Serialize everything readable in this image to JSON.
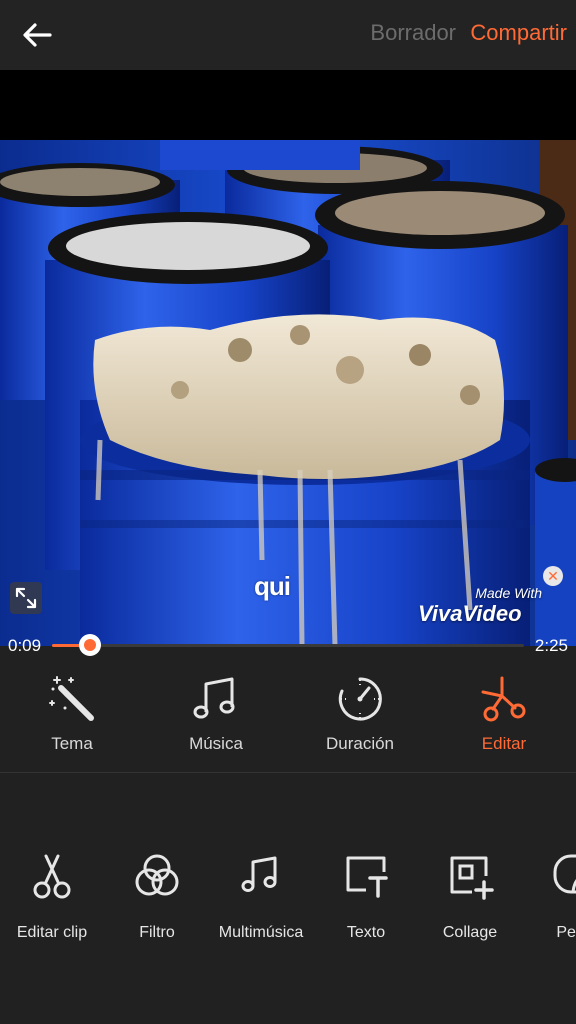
{
  "header": {
    "back_label": "",
    "draft_label": "Borrador",
    "share_label": "Compartir"
  },
  "colors": {
    "accent": "#ff6a35",
    "background": "#212121",
    "muted_text": "#6c6c6c"
  },
  "preview": {
    "caption_text": "qui",
    "watermark_made_with": "Made With",
    "watermark_brand": "VivaVideo",
    "fullscreen_icon": "expand-icon",
    "watermark_close_icon": "close-icon"
  },
  "playback": {
    "current_time": "0:09",
    "total_time": "2:25",
    "progress": 0.08
  },
  "main_tabs": [
    {
      "label": "Tema",
      "icon": "magic-wand-icon",
      "active": false
    },
    {
      "label": "Música",
      "icon": "music-note-icon",
      "active": false
    },
    {
      "label": "Duración",
      "icon": "timer-icon",
      "active": false
    },
    {
      "label": "Editar",
      "icon": "scissors-icon",
      "active": true
    }
  ],
  "tools": [
    {
      "label": "Editar clip",
      "icon": "scissors-icon"
    },
    {
      "label": "Filtro",
      "icon": "filter-circles-icon"
    },
    {
      "label": "Multimúsica",
      "icon": "music-note-icon"
    },
    {
      "label": "Texto",
      "icon": "text-frame-icon"
    },
    {
      "label": "Collage",
      "icon": "collage-add-icon"
    },
    {
      "label": "Pega",
      "icon": "sticker-icon"
    }
  ]
}
